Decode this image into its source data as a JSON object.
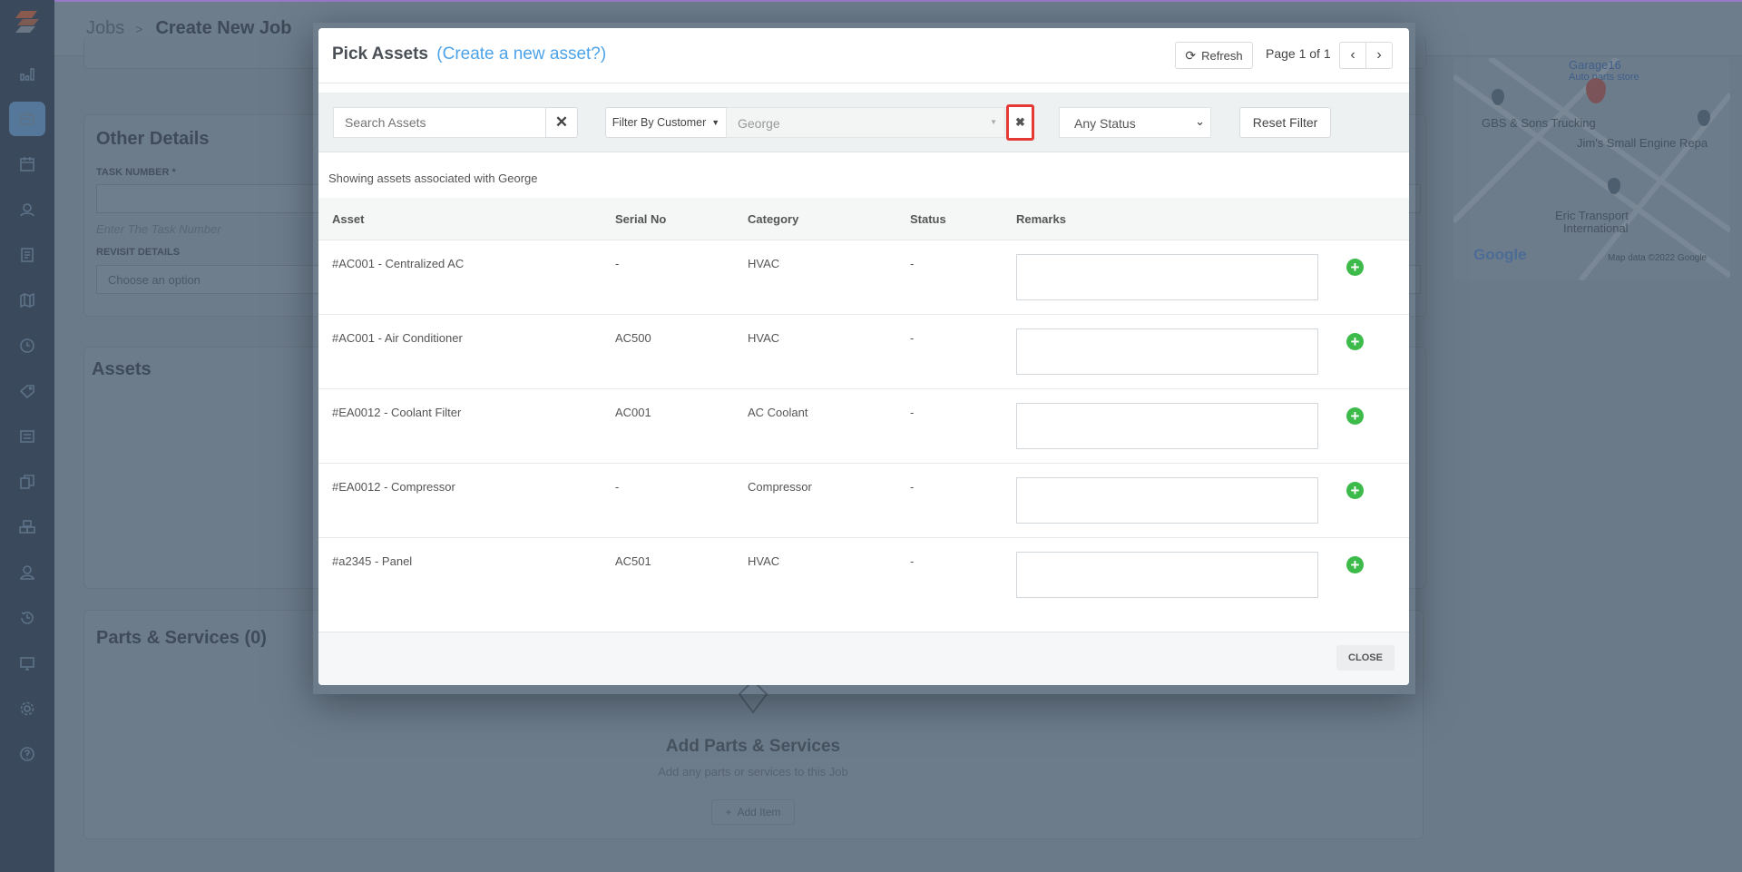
{
  "breadcrumb": {
    "parent": "Jobs",
    "separator": ">",
    "current": "Create New Job"
  },
  "background": {
    "other_details": {
      "title": "Other Details",
      "task_number_label": "TASK NUMBER *",
      "task_number_hint": "Enter The Task Number",
      "revisit_label": "REVISIT DETAILS",
      "revisit_value": "Choose an option"
    },
    "assets_title": "Assets",
    "parts": {
      "title": "Parts & Services (0)",
      "empty_title": "Add Parts & Services",
      "empty_text": "Add any parts or services to this Job",
      "add_button": "Add Item"
    },
    "map": {
      "labels": [
        "Garage16",
        "Auto parts store",
        "GBS & Sons Trucking",
        "Jim's Small Engine Repa",
        "Eric Transport",
        "International"
      ],
      "logo": "Google",
      "attribution": "Map data ©2022 Google"
    }
  },
  "modal": {
    "title": "Pick Assets",
    "create_link": "(Create a new asset?)",
    "refresh_label": "Refresh",
    "page_info": "Page 1 of 1",
    "filters": {
      "search_placeholder": "Search Assets",
      "filter_by_label": "Filter By Customer",
      "customer_value": "George",
      "status_value": "Any Status",
      "reset_label": "Reset Filter"
    },
    "showing_text": "Showing assets associated with George",
    "columns": [
      "Asset",
      "Serial No",
      "Category",
      "Status",
      "Remarks"
    ],
    "rows": [
      {
        "asset": "#AC001 - Centralized AC",
        "serial": "-",
        "category": "HVAC",
        "status": "-"
      },
      {
        "asset": "#AC001 - Air Conditioner",
        "serial": "AC500",
        "category": "HVAC",
        "status": "-"
      },
      {
        "asset": "#EA0012 - Coolant Filter",
        "serial": "AC001",
        "category": "AC Coolant",
        "status": "-"
      },
      {
        "asset": "#EA0012 - Compressor",
        "serial": "-",
        "category": "Compressor",
        "status": "-"
      },
      {
        "asset": "#a2345 - Panel",
        "serial": "AC501",
        "category": "HVAC",
        "status": "-"
      }
    ],
    "close_label": "CLOSE"
  },
  "colors": {
    "accent": "#4da3e8",
    "add": "#3dbb4a",
    "highlight": "#e53935",
    "sidebar": "#3a4a5c"
  }
}
